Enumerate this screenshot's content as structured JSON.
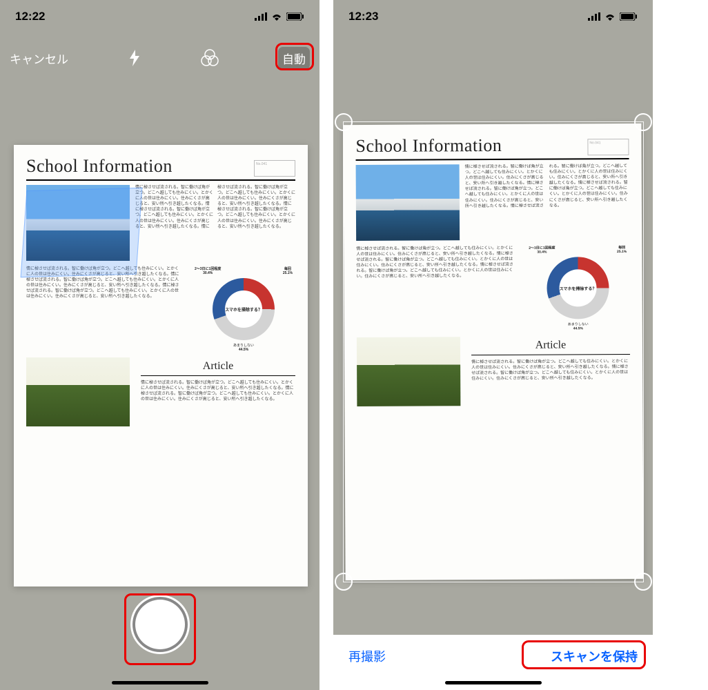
{
  "left": {
    "time": "12:22",
    "toolbar": {
      "cancel": "キャンセル",
      "auto": "自動"
    }
  },
  "right": {
    "time": "12:23",
    "bottombar": {
      "retake": "再撮影",
      "save": "スキャンを保持"
    }
  },
  "document": {
    "title": "School Information",
    "article_heading": "Article",
    "donut_question": "スマホを掃除する？",
    "donut_labels": {
      "left_top": "2～3日に1回程度",
      "right_top": "毎回"
    },
    "donut_bottom": "あまりしない",
    "body_snippet": "情に棹させば流される。智に働けば角が立つ。どこへ越しても住みにくい。とかくに人の世は住みにくい。住みにくさが高じると、安い所へ引き越したくなる。"
  },
  "chart_data": {
    "type": "pie",
    "title": "スマホを掃除する？",
    "series": [
      {
        "name": "2～3日に1回程度",
        "value": 30.4
      },
      {
        "name": "毎回",
        "value": 25.1
      },
      {
        "name": "あまりしない",
        "value": 44.5
      }
    ],
    "value_labels": {
      "left": "30.4%",
      "right": "25.1%",
      "bottom": "44.5%"
    }
  }
}
